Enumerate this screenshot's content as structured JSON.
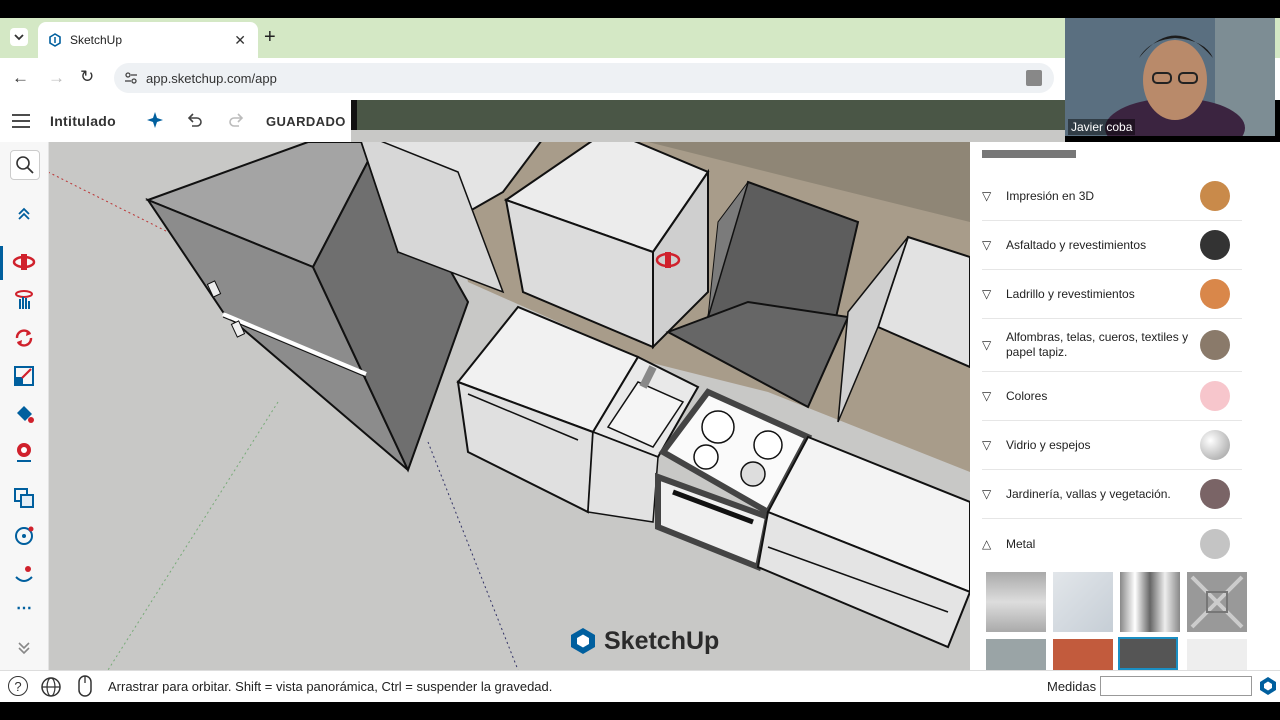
{
  "browser": {
    "tab_title": "SketchUp",
    "url": "app.sketchup.com/app"
  },
  "app": {
    "document_title": "Intitulado",
    "save_status": "GUARDADO",
    "brand_watermark": "SketchUp"
  },
  "materials": {
    "categories": [
      {
        "label": "Impresión en 3D",
        "color": "#c98a4a",
        "expanded": false
      },
      {
        "label": "Asfaltado y revestimientos",
        "color": "#333333",
        "expanded": false
      },
      {
        "label": "Ladrillo y revestimientos",
        "color": "#d9874a",
        "expanded": false
      },
      {
        "label": "Alfombras, telas, cueros, textiles y papel tapiz.",
        "color": "#8a7a6a",
        "expanded": false
      },
      {
        "label": "Colores",
        "color": "#f7c6cc",
        "expanded": false
      },
      {
        "label": "Vidrio y espejos",
        "color": "#bdbdbd",
        "expanded": false
      },
      {
        "label": "Jardinería, vallas y vegetación.",
        "color": "#7a6466",
        "expanded": false
      },
      {
        "label": "Metal",
        "color": "#c4c4c4",
        "expanded": true
      }
    ]
  },
  "status": {
    "hint": "Arrastrar para orbitar. Shift = vista panorámica, Ctrl = suspender la gravedad.",
    "measurements_label": "Medidas",
    "measurements_value": ""
  },
  "webcam": {
    "participant_name": "Javier coba"
  },
  "colors": {
    "accent": "#005f9e",
    "tool_red": "#d0212c",
    "tab_strip": "#d4e8c5",
    "header_dark": "#4a5646"
  }
}
